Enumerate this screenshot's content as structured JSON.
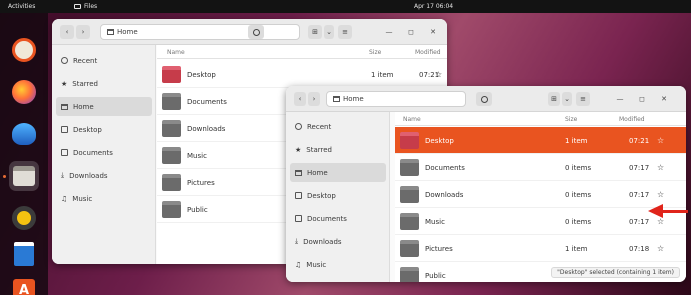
{
  "topbar": {
    "activities": "Activities",
    "app_menu": "Files",
    "clock": "Apr 17  06:04"
  },
  "dock": {
    "items": [
      {
        "icon": "help-icon"
      },
      {
        "icon": "firefox-icon"
      },
      {
        "icon": "thunderbird-icon"
      },
      {
        "icon": "files-icon"
      },
      {
        "icon": "rhythmbox-icon"
      },
      {
        "icon": "writer-icon"
      },
      {
        "icon": "software-icon",
        "glyph": "A"
      }
    ]
  },
  "back_window": {
    "path": "Home",
    "header_buttons": {
      "view": "⊞",
      "menu": "≡",
      "minimize": "—",
      "maximize": "◻",
      "close": "✕",
      "nav_back": "‹",
      "nav_forward": "›",
      "sort": "⌄"
    },
    "columns": {
      "name": "Name",
      "size": "Size",
      "modified": "Modified"
    },
    "sidebar": [
      {
        "label": "Recent",
        "icon": "clock-icon"
      },
      {
        "label": "Starred",
        "icon": "star-icon"
      },
      {
        "label": "Home",
        "icon": "home-icon",
        "active": true
      },
      {
        "label": "Desktop",
        "icon": "desktop-icon"
      },
      {
        "label": "Documents",
        "icon": "document-icon"
      },
      {
        "label": "Downloads",
        "icon": "download-icon"
      },
      {
        "label": "Music",
        "icon": "music-icon"
      }
    ],
    "rows": [
      {
        "name": "Desktop",
        "size": "1 item",
        "modified": "07:21",
        "star": "☆",
        "kind": "desktop"
      },
      {
        "name": "Documents",
        "size": "",
        "modified": "",
        "star": "",
        "kind": "folder"
      },
      {
        "name": "Downloads",
        "size": "",
        "modified": "",
        "star": "",
        "kind": "folder"
      },
      {
        "name": "Music",
        "size": "",
        "modified": "",
        "star": "",
        "kind": "folder"
      },
      {
        "name": "Pictures",
        "size": "",
        "modified": "",
        "star": "",
        "kind": "folder"
      },
      {
        "name": "Public",
        "size": "",
        "modified": "",
        "star": "",
        "kind": "folder"
      }
    ]
  },
  "front_window": {
    "path": "Home",
    "header_buttons": {
      "view": "⊞",
      "menu": "≡",
      "minimize": "—",
      "maximize": "◻",
      "close": "✕",
      "nav_back": "‹",
      "nav_forward": "›",
      "sort": "⌄",
      "search": ""
    },
    "columns": {
      "name": "Name",
      "size": "Size",
      "modified": "Modified"
    },
    "sidebar": [
      {
        "label": "Recent",
        "icon": "clock-icon"
      },
      {
        "label": "Starred",
        "icon": "star-icon"
      },
      {
        "label": "Home",
        "icon": "home-icon",
        "active": true
      },
      {
        "label": "Desktop",
        "icon": "desktop-icon"
      },
      {
        "label": "Documents",
        "icon": "document-icon"
      },
      {
        "label": "Downloads",
        "icon": "download-icon"
      },
      {
        "label": "Music",
        "icon": "music-icon"
      }
    ],
    "rows": [
      {
        "name": "Desktop",
        "size": "1 item",
        "modified": "07:21",
        "star": "☆",
        "selected": true,
        "kind": "desktop"
      },
      {
        "name": "Documents",
        "size": "0 items",
        "modified": "07:17",
        "star": "☆",
        "kind": "folder"
      },
      {
        "name": "Downloads",
        "size": "0 items",
        "modified": "07:17",
        "star": "☆",
        "kind": "folder"
      },
      {
        "name": "Music",
        "size": "0 items",
        "modified": "07:17",
        "star": "☆",
        "kind": "folder"
      },
      {
        "name": "Pictures",
        "size": "1 item",
        "modified": "07:18",
        "star": "☆",
        "kind": "folder"
      },
      {
        "name": "Public",
        "size": "",
        "modified": "",
        "star": "",
        "kind": "folder"
      }
    ],
    "status": "\"Desktop\" selected (containing 1 item)"
  },
  "colors": {
    "accent": "#e95420",
    "annotation_arrow": "#e0241b"
  },
  "annotation": {
    "icon": "arrow-left-icon"
  }
}
